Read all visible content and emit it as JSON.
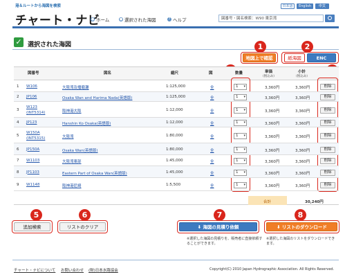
{
  "header": {
    "tagline": "港＆ルートから海図を検索",
    "logo": "チャート・ナビ",
    "nav": [
      {
        "label": "ホーム",
        "icon": "home-icon"
      },
      {
        "label": "選択された海図",
        "icon": "chart-icon"
      },
      {
        "label": "ヘルプ",
        "icon": "help-icon"
      }
    ],
    "lang": [
      "日本語",
      "English",
      "中文"
    ],
    "search_value": "図番号・図名検索：W90 東京湾"
  },
  "page_title": "選択された海図",
  "actions": {
    "map_confirm": "地図上で確認",
    "paper_chart": "紙海図",
    "enc": "ENC",
    "add_search": "追加検索",
    "clear_list": "リストのクリア",
    "estimate": "海図の見積り依頼",
    "download": "リストのダウンロード",
    "estimate_note": "※選択した海図の見積りを、販売者に直接依頼することができます。",
    "download_note": "※選択した海図のリストをダウンロードできます。"
  },
  "callouts": [
    "1",
    "2",
    "3",
    "4",
    "5",
    "6",
    "7",
    "8"
  ],
  "table": {
    "headers": {
      "number": "図番号",
      "name": "図名",
      "scale": "縮尺",
      "chart": "図",
      "qty": "数量",
      "unit_price": "単価",
      "unit_price_sub": "(税込み)",
      "subtotal": "小計",
      "subtotal_sub": "(税込み)"
    },
    "rows": [
      {
        "no": "1",
        "code": "W106",
        "code2": "",
        "name": "大阪湾及播磨灘",
        "scale": "1:125,000",
        "chart": "全",
        "qty": "1",
        "price": "3,360円",
        "subtotal": "3,360円",
        "delete": "削除"
      },
      {
        "no": "2",
        "code": "JP106",
        "code2": "",
        "name": "Osaka Wan and Harima Nada(英語版)",
        "scale": "1:125,000",
        "chart": "全",
        "qty": "1",
        "price": "3,360円",
        "subtotal": "3,360円",
        "delete": "削除"
      },
      {
        "no": "3",
        "code": "W123",
        "code2": "(INT5314)",
        "name": "阪神港大阪",
        "scale": "1:12,000",
        "chart": "全",
        "qty": "1",
        "price": "3,360円",
        "subtotal": "3,360円",
        "delete": "削除"
      },
      {
        "no": "4",
        "code": "JP123",
        "code2": "",
        "name": "Hanshin Ko Osaka(英語版)",
        "scale": "1:12,000",
        "chart": "全",
        "qty": "1",
        "price": "3,360円",
        "subtotal": "3,360円",
        "delete": "削除"
      },
      {
        "no": "5",
        "code": "W150A",
        "code2": "(INT5315)",
        "name": "大阪湾",
        "scale": "1:80,000",
        "chart": "全",
        "qty": "1",
        "price": "3,360円",
        "subtotal": "3,360円",
        "delete": "削除"
      },
      {
        "no": "6",
        "code": "JP150A",
        "code2": "",
        "name": "Osaka Wan(英語版)",
        "scale": "1:80,000",
        "chart": "全",
        "qty": "1",
        "price": "3,360円",
        "subtotal": "3,360円",
        "delete": "削除"
      },
      {
        "no": "7",
        "code": "W1103",
        "code2": "",
        "name": "大阪湾東部",
        "scale": "1:45,000",
        "chart": "全",
        "qty": "1",
        "price": "3,360円",
        "subtotal": "3,360円",
        "delete": "削除"
      },
      {
        "no": "8",
        "code": "JP1103",
        "code2": "",
        "name": "Eastern Part of Osaka Wan(英語版)",
        "scale": "1:45,000",
        "chart": "全",
        "qty": "1",
        "price": "3,360円",
        "subtotal": "3,360円",
        "delete": "削除"
      },
      {
        "no": "9",
        "code": "W1148",
        "code2": "",
        "name": "阪神港尼崎",
        "scale": "1:5,500",
        "chart": "全",
        "qty": "1",
        "price": "3,360円",
        "subtotal": "3,360円",
        "delete": "削除"
      }
    ],
    "total_label": "合計",
    "total_value": "30,240円"
  },
  "footer": {
    "links": [
      "チャート・ナビについて",
      "お問い合わせ",
      "(財)日本水路協会"
    ],
    "copyright": "Copyright(C) 2010 Japan Hydrographic Association. All Rights Reserved."
  },
  "colors": {
    "accent": "#d9261c",
    "brand": "#3a6fb0",
    "orange": "#f07e27",
    "check": "#2f9b3f"
  }
}
